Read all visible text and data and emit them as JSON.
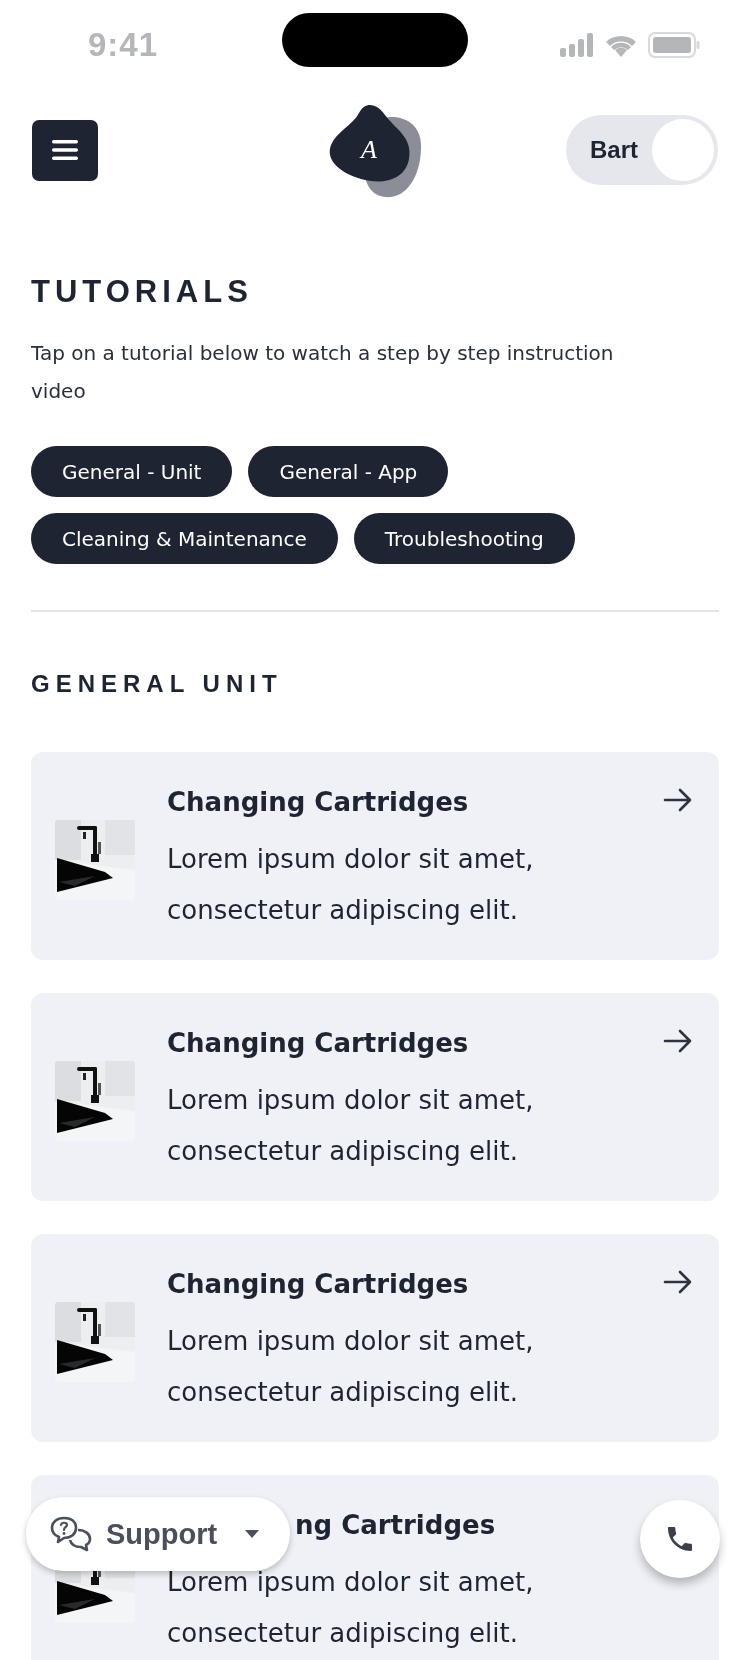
{
  "status_bar": {
    "time": "9:41"
  },
  "header": {
    "logo_letter": "A",
    "user_name": "Bart"
  },
  "page": {
    "title": "TUTORIALS",
    "description": "Tap on a tutorial below to watch a step by step instruction video",
    "filters": [
      {
        "label": "General - Unit"
      },
      {
        "label": "General - App"
      },
      {
        "label": "Cleaning & Maintenance"
      },
      {
        "label": "Troubleshooting"
      }
    ],
    "section_title": "GENERAL UNIT"
  },
  "tutorials": [
    {
      "title": "Changing Cartridges",
      "description": "Lorem ipsum dolor sit amet, consectetur adipiscing elit.",
      "covered": false
    },
    {
      "title": "Changing Cartridges",
      "description": "Lorem ipsum dolor sit amet, consectetur adipiscing elit.",
      "covered": false
    },
    {
      "title": "Changing Cartridges",
      "description": "Lorem ipsum dolor sit amet, consectetur adipiscing elit.",
      "covered": false
    },
    {
      "title": "ng Cartridges",
      "description": "Lorem ipsum dolor sit amet, consectetur adipiscing elit.",
      "covered": true
    }
  ],
  "support": {
    "label": "Support"
  }
}
